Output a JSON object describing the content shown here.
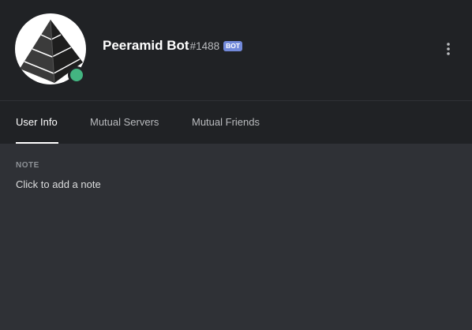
{
  "profile": {
    "username": "Peeramid Bot",
    "discriminator": "#1488",
    "bot_tag": "BOT",
    "status": "online",
    "status_color": "#43b581",
    "avatar_icon": "pyramid-logo"
  },
  "header": {
    "more_icon": "vertical-ellipsis-icon"
  },
  "tabs": [
    {
      "label": "User Info",
      "active": true
    },
    {
      "label": "Mutual Servers",
      "active": false
    },
    {
      "label": "Mutual Friends",
      "active": false
    }
  ],
  "note": {
    "heading": "NOTE",
    "placeholder": "Click to add a note"
  },
  "colors": {
    "background": "#2f3136",
    "header": "#202225",
    "accent": "#7289da",
    "online": "#43b581"
  }
}
